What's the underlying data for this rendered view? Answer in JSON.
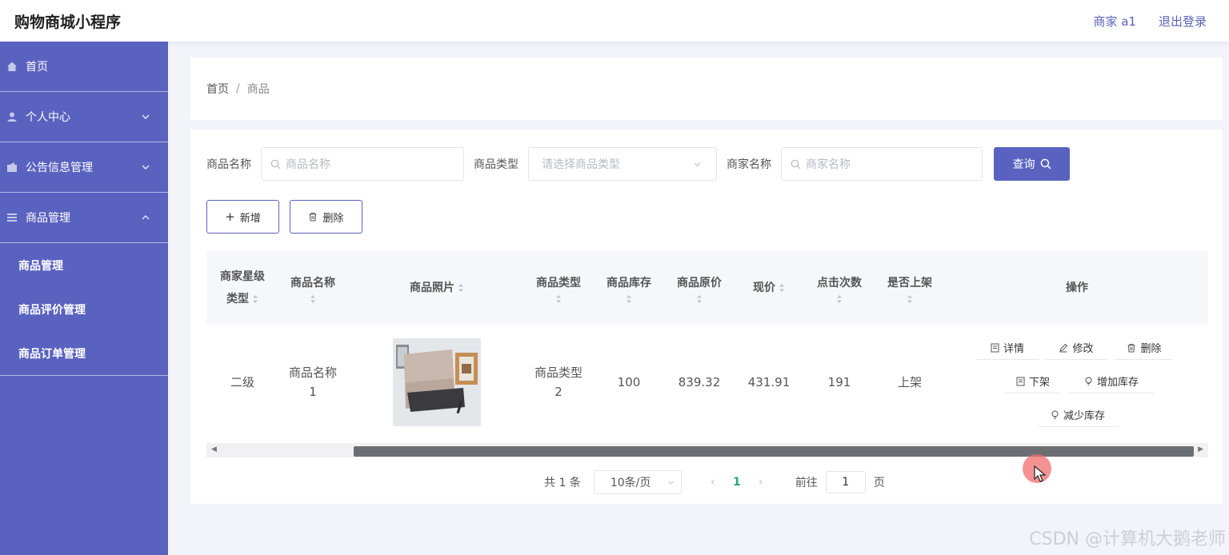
{
  "header": {
    "app_title": "购物商城小程序",
    "user": "商家 a1",
    "logout": "退出登录"
  },
  "sidebar": {
    "items": [
      {
        "label": "首页",
        "icon": "home-icon"
      },
      {
        "label": "个人中心",
        "icon": "user-icon"
      },
      {
        "label": "公告信息管理",
        "icon": "notice-icon"
      },
      {
        "label": "商品管理",
        "icon": "list-icon"
      }
    ],
    "sub_items": [
      "商品管理",
      "商品评价管理",
      "商品订单管理"
    ]
  },
  "breadcrumb": {
    "home": "首页",
    "sep": "/",
    "current": "商品"
  },
  "search": {
    "name_label": "商品名称",
    "name_placeholder": "商品名称",
    "type_label": "商品类型",
    "type_placeholder": "请选择商品类型",
    "shop_label": "商家名称",
    "shop_placeholder": "商家名称",
    "query_button": "查询"
  },
  "actions": {
    "add": "新增",
    "delete": "删除"
  },
  "table": {
    "headers": {
      "level_1": "商家星级",
      "level_2": "类型",
      "name": "商品名称",
      "photo": "商品照片",
      "type": "商品类型",
      "stock": "商品库存",
      "original_price": "商品原价",
      "price": "现价",
      "clicks": "点击次数",
      "onshelf": "是否上架",
      "ops": "操作"
    },
    "row": {
      "level": "二级",
      "name_1": "商品名称",
      "name_2": "1",
      "type_1": "商品类型",
      "type_2": "2",
      "stock": "100",
      "original_price": "839.32",
      "price": "431.91",
      "clicks": "191",
      "onshelf": "上架"
    },
    "ops": {
      "detail": "详情",
      "edit": "修改",
      "delete": "删除",
      "off_shelf": "下架",
      "add_stock": "增加库存",
      "reduce_stock": "减少库存"
    }
  },
  "pagination": {
    "total": "共 1 条",
    "page_size": "10条/页",
    "current_page": "1",
    "goto_label": "前往",
    "goto_value": "1",
    "page_unit": "页"
  },
  "watermark": "CSDN @计算机大鹅老师",
  "colors": {
    "accent": "#5a62bf",
    "page_active": "#2aa37a"
  }
}
